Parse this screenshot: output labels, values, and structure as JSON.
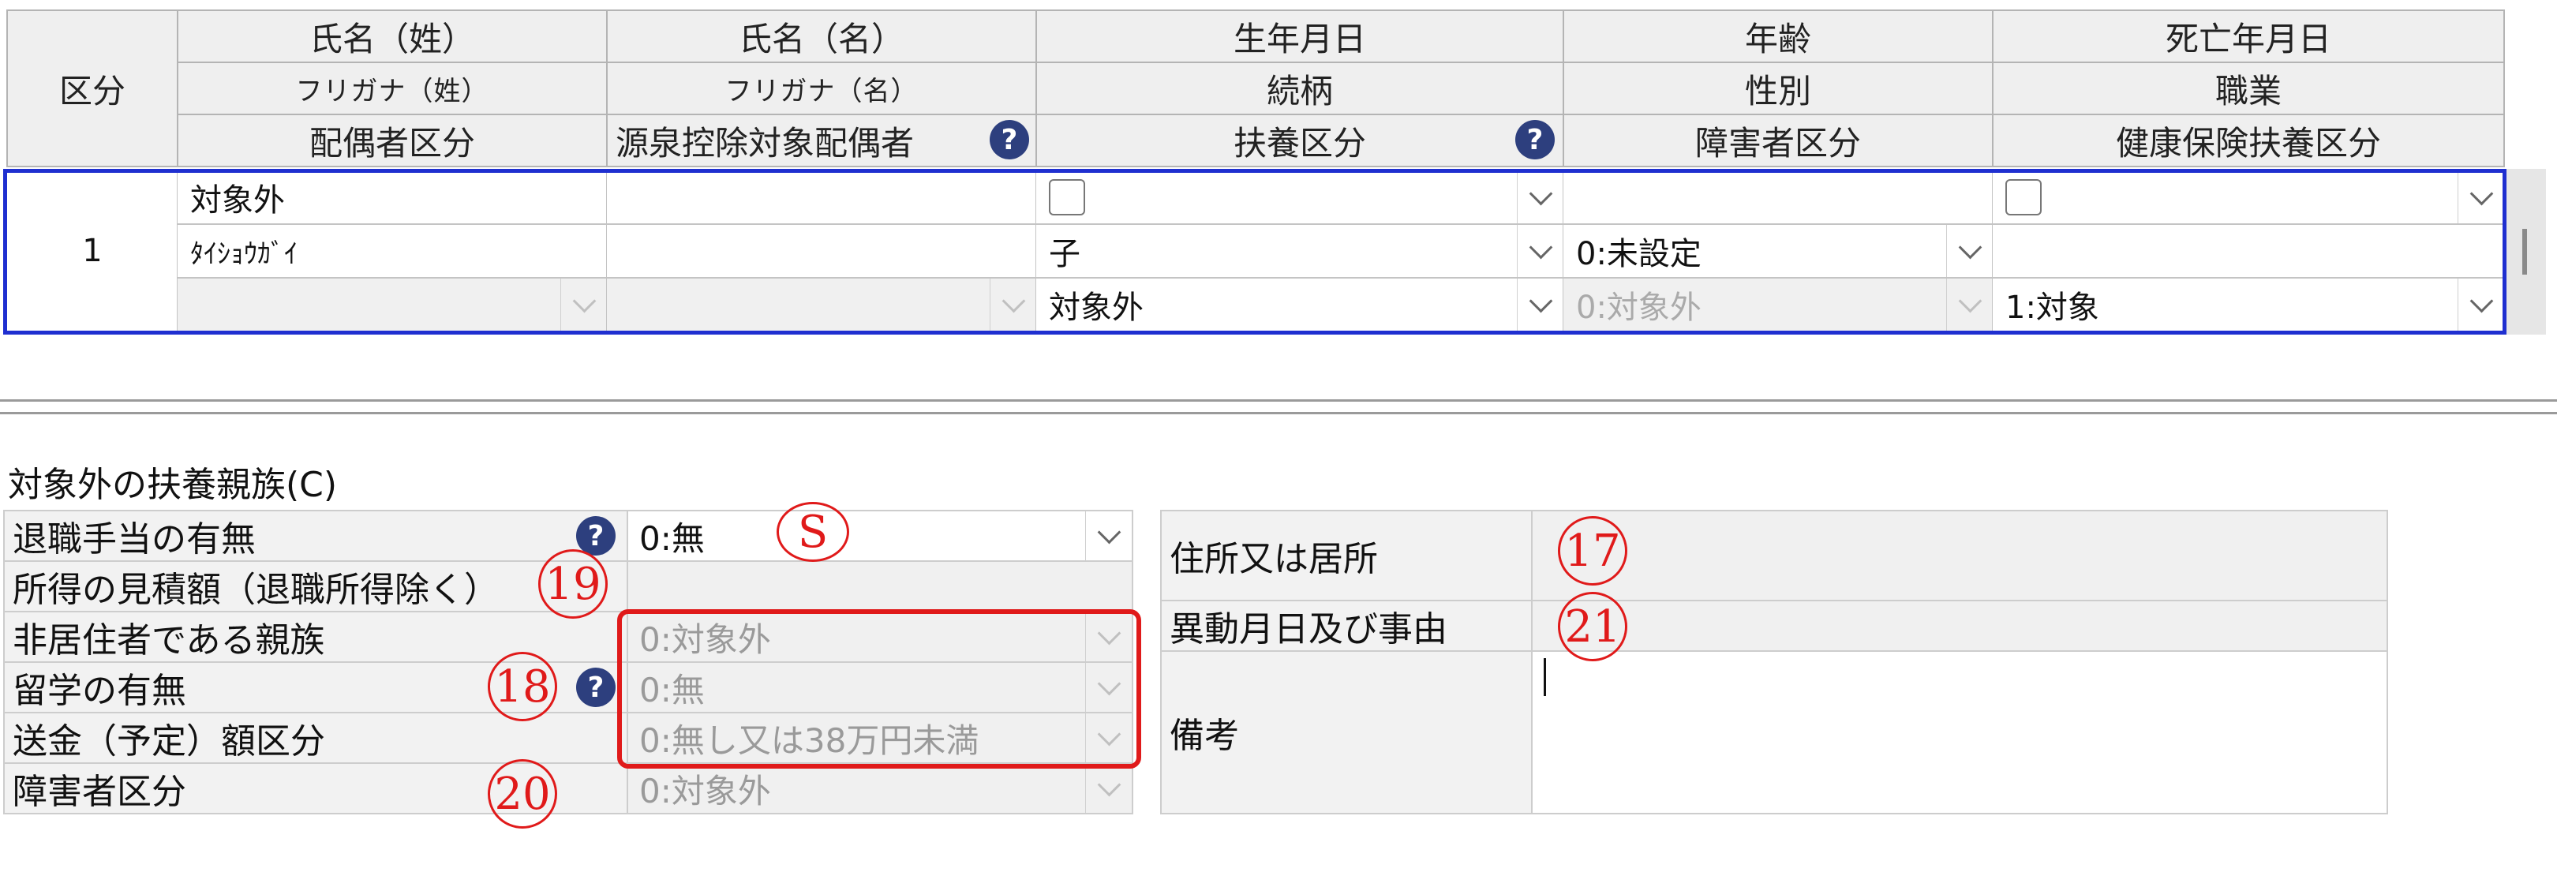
{
  "grid": {
    "header_row1": [
      "区分",
      "氏名（姓）",
      "氏名（名）",
      "生年月日",
      "年齢",
      "死亡年月日"
    ],
    "header_row2": [
      "フリガナ（姓）",
      "フリガナ（名）",
      "続柄",
      "性別",
      "職業"
    ],
    "header_row3": [
      "配偶者区分",
      "源泉控除対象配偶者",
      "扶養区分",
      "障害者区分",
      "健康保険扶養区分"
    ],
    "record": {
      "index": "1",
      "name_sei": "対象外",
      "kana_sei": "ﾀｲｼｮｳｶﾞｲ",
      "relation": "子",
      "gender": "0:未設定",
      "fuyou_kubun": "対象外",
      "shougaisha_kubun": "0:対象外",
      "kenpo_fuyou": "1:対象"
    }
  },
  "section": {
    "title": "対象外の扶養親族(C)",
    "left_rows": [
      {
        "label": "退職手当の有無",
        "value": "0:無"
      },
      {
        "label": "所得の見積額（退職所得除く）",
        "value": ""
      },
      {
        "label": "非居住者である親族",
        "value": "0:対象外"
      },
      {
        "label": "留学の有無",
        "value": "0:無"
      },
      {
        "label": "送金（予定）額区分",
        "value": "0:無し又は38万円未満"
      },
      {
        "label": "障害者区分",
        "value": "0:対象外"
      }
    ],
    "right_rows": [
      {
        "label": "住所又は居所",
        "value": ""
      },
      {
        "label": "異動月日及び事由",
        "value": ""
      },
      {
        "label": "備考",
        "value": ""
      }
    ]
  },
  "help_icon": "question-circle-icon",
  "markers": [
    "S",
    "17",
    "19",
    "21",
    "18",
    "20"
  ],
  "colors": {
    "selection_border": "#1f2fd0",
    "marker_red": "#e01a1a",
    "help_icon_bg": "#2d3f7e"
  }
}
